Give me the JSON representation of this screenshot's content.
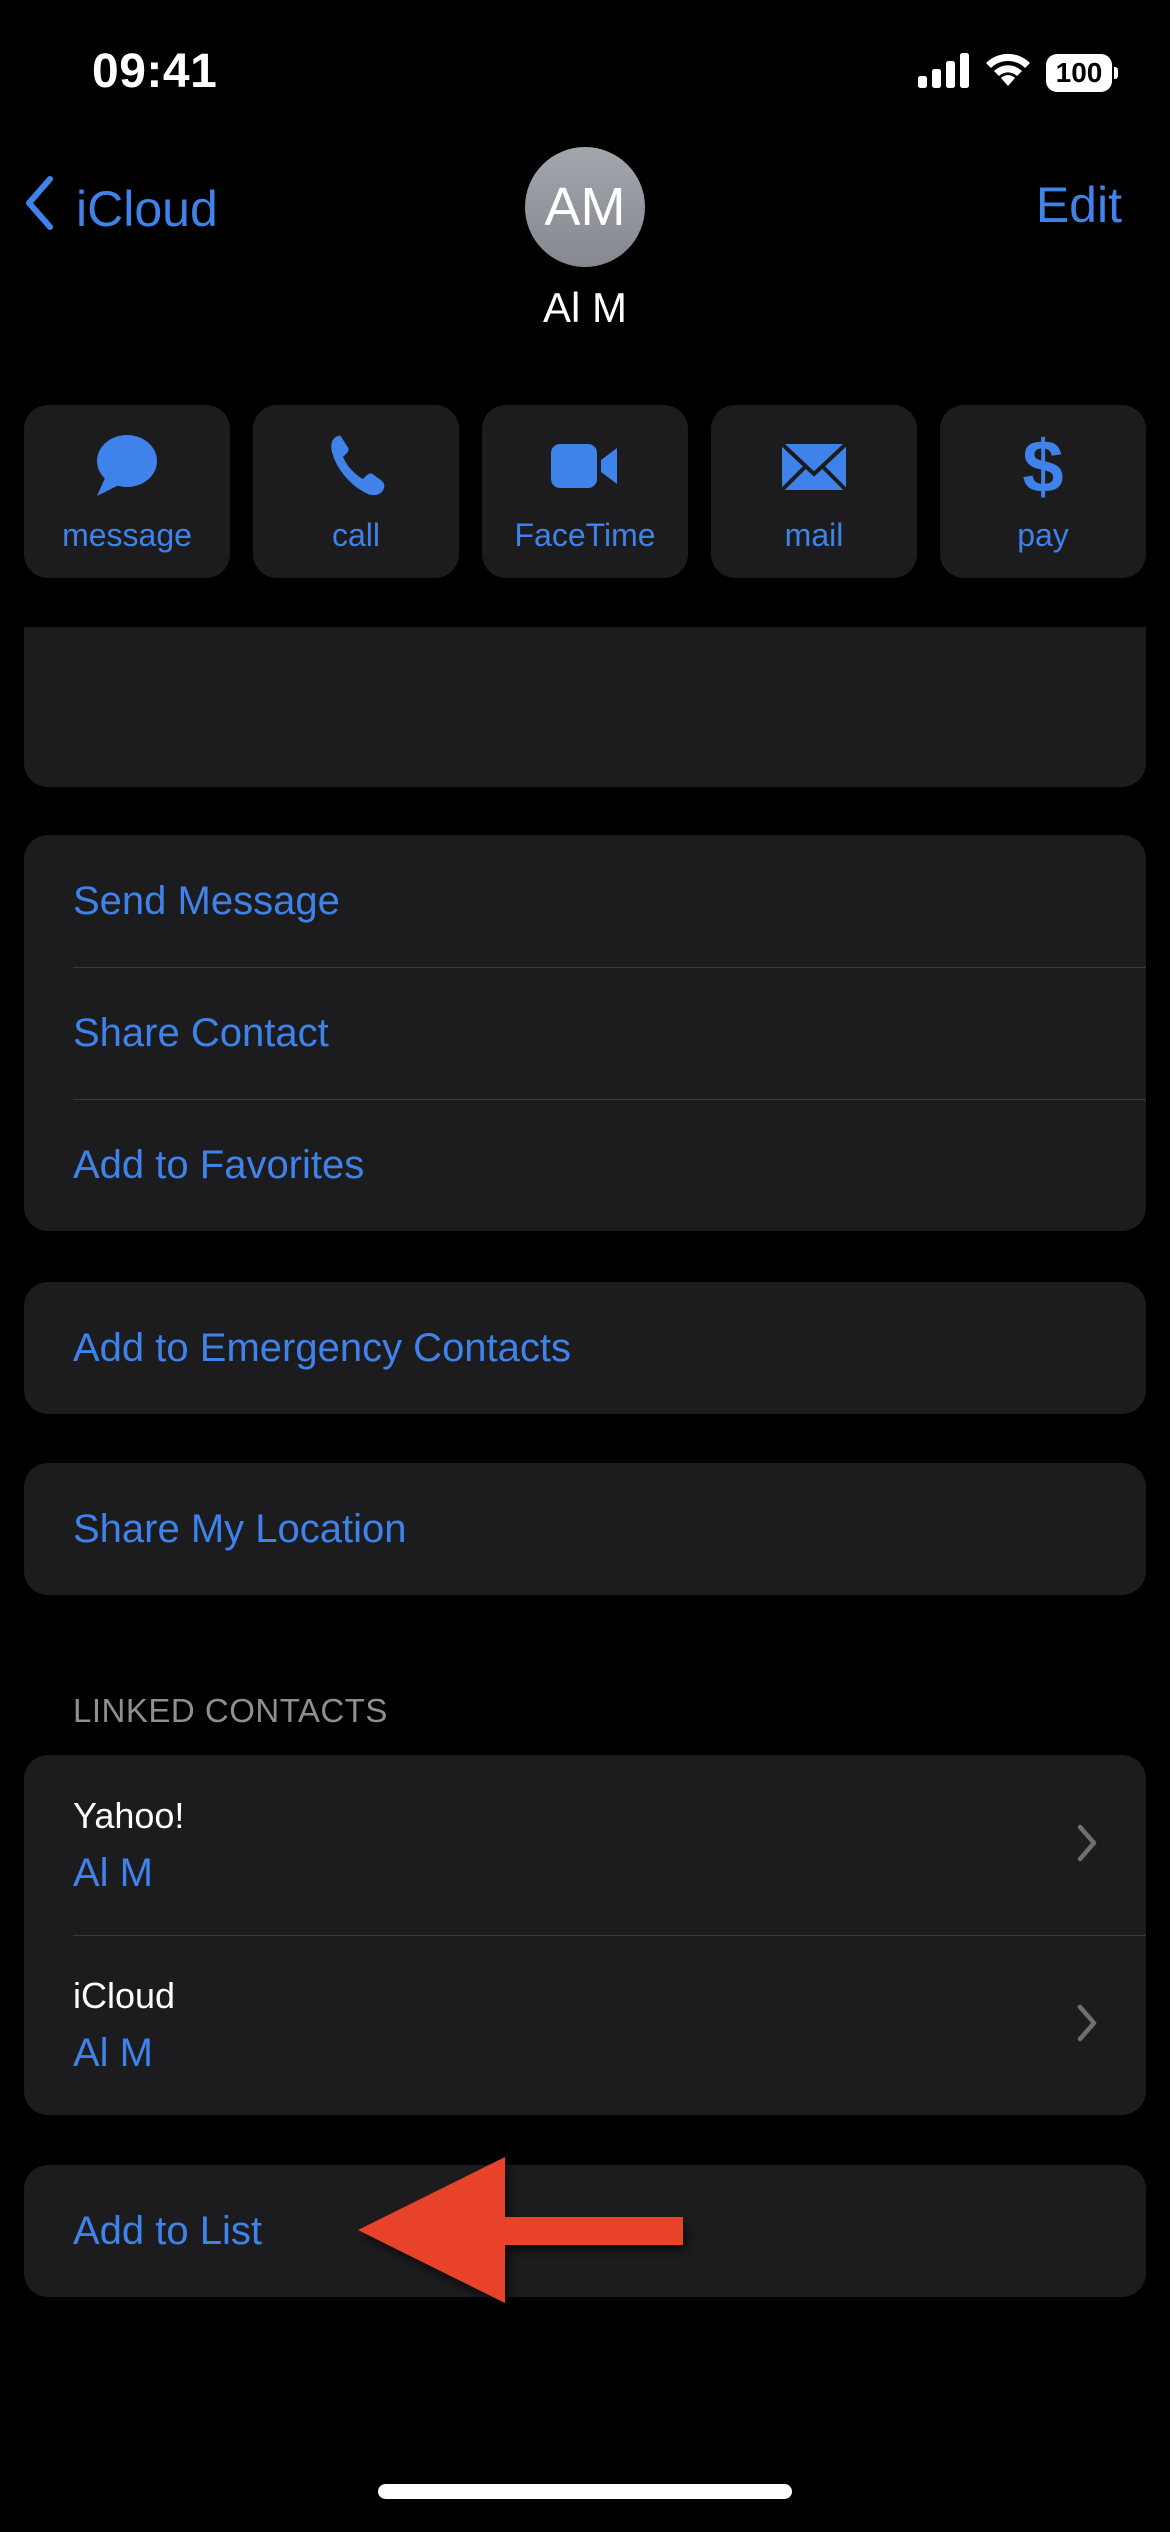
{
  "status_bar": {
    "time": "09:41",
    "battery_level": "100",
    "icons": [
      "cellular-signal-icon",
      "wifi-icon",
      "battery-icon"
    ]
  },
  "nav": {
    "back_label": "iCloud",
    "back_icon": "chevron-left-icon",
    "edit_label": "Edit"
  },
  "contact": {
    "initials": "AM",
    "name": "Al M"
  },
  "quick_actions": [
    {
      "label": "message",
      "icon": "message-bubble-icon"
    },
    {
      "label": "call",
      "icon": "phone-icon"
    },
    {
      "label": "FaceTime",
      "icon": "video-camera-icon"
    },
    {
      "label": "mail",
      "icon": "envelope-icon"
    },
    {
      "label": "pay",
      "icon": "dollar-icon"
    }
  ],
  "action_list": [
    {
      "label": "Send Message"
    },
    {
      "label": "Share Contact"
    },
    {
      "label": "Add to Favorites"
    }
  ],
  "emergency": {
    "label": "Add to Emergency Contacts"
  },
  "location": {
    "label": "Share My Location"
  },
  "linked_contacts": {
    "header": "LINKED CONTACTS",
    "items": [
      {
        "source": "Yahoo!",
        "name": "Al M"
      },
      {
        "source": "iCloud",
        "name": "Al M"
      }
    ]
  },
  "add_to_list": {
    "label": "Add to List"
  },
  "colors": {
    "accent": "#3f82ea",
    "background": "#000000",
    "card": "#1c1c1e",
    "separator": "#3a3a3c",
    "secondary_text": "#8e8e93",
    "annotation_arrow": "#e8432a"
  }
}
